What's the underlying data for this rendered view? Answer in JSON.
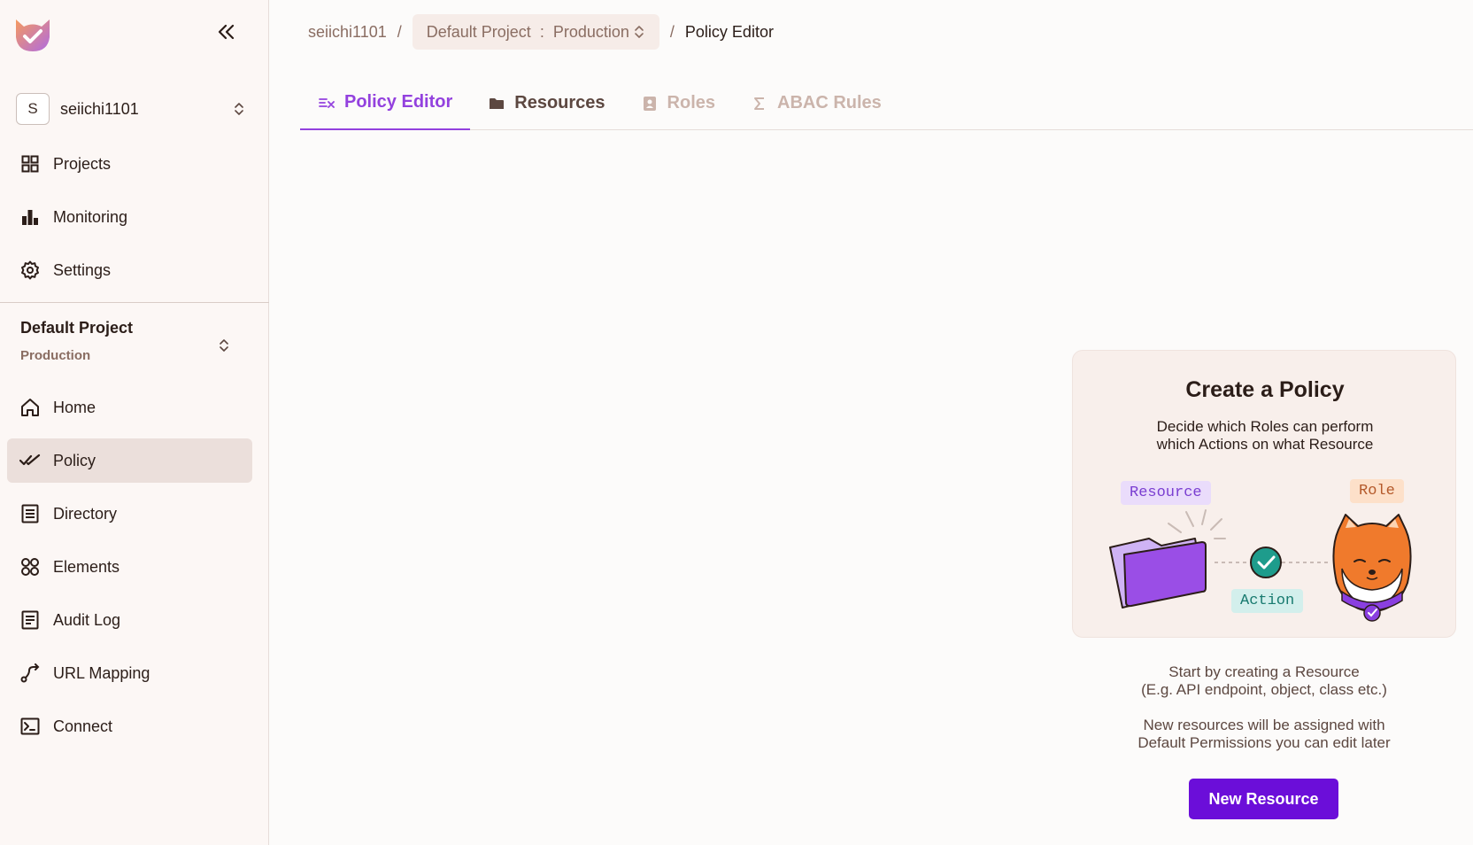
{
  "sidebar": {
    "org": {
      "initial": "S",
      "name": "seiichi1101"
    },
    "top_nav": [
      {
        "label": "Projects",
        "icon": "grid-icon"
      },
      {
        "label": "Monitoring",
        "icon": "bar-chart-icon"
      },
      {
        "label": "Settings",
        "icon": "gear-icon"
      }
    ],
    "project": {
      "name": "Default Project",
      "environment": "Production"
    },
    "project_nav": [
      {
        "label": "Home",
        "icon": "home-icon"
      },
      {
        "label": "Policy",
        "icon": "double-check-icon",
        "active": true
      },
      {
        "label": "Directory",
        "icon": "directory-icon"
      },
      {
        "label": "Elements",
        "icon": "elements-icon"
      },
      {
        "label": "Audit Log",
        "icon": "audit-log-icon"
      },
      {
        "label": "URL Mapping",
        "icon": "route-icon"
      },
      {
        "label": "Connect",
        "icon": "terminal-icon"
      }
    ]
  },
  "breadcrumb": {
    "org": "seiichi1101",
    "sep": "/",
    "project": "Default Project",
    "colon": ":",
    "environment": "Production",
    "current": "Policy Editor"
  },
  "tabs": [
    {
      "label": "Policy Editor",
      "state": "active"
    },
    {
      "label": "Resources",
      "state": "normal"
    },
    {
      "label": "Roles",
      "state": "disabled"
    },
    {
      "label": "ABAC Rules",
      "state": "disabled"
    }
  ],
  "empty_state": {
    "title": "Create a Policy",
    "subtitle_line1": "Decide which Roles can perform",
    "subtitle_line2": "which Actions on what Resource",
    "tags": {
      "resource": "Resource",
      "role": "Role",
      "action": "Action"
    },
    "hint1_line1": "Start by creating a Resource",
    "hint1_line2": "(E.g. API endpoint, object, class etc.)",
    "hint2_line1": "New resources will be assigned with",
    "hint2_line2": "Default Permissions you can edit later",
    "button": "New Resource"
  },
  "colors": {
    "accent": "#9341de",
    "button": "#6b0ed9",
    "sidebar_bg": "#fcf7f5",
    "active_nav": "#ebdfdb"
  }
}
